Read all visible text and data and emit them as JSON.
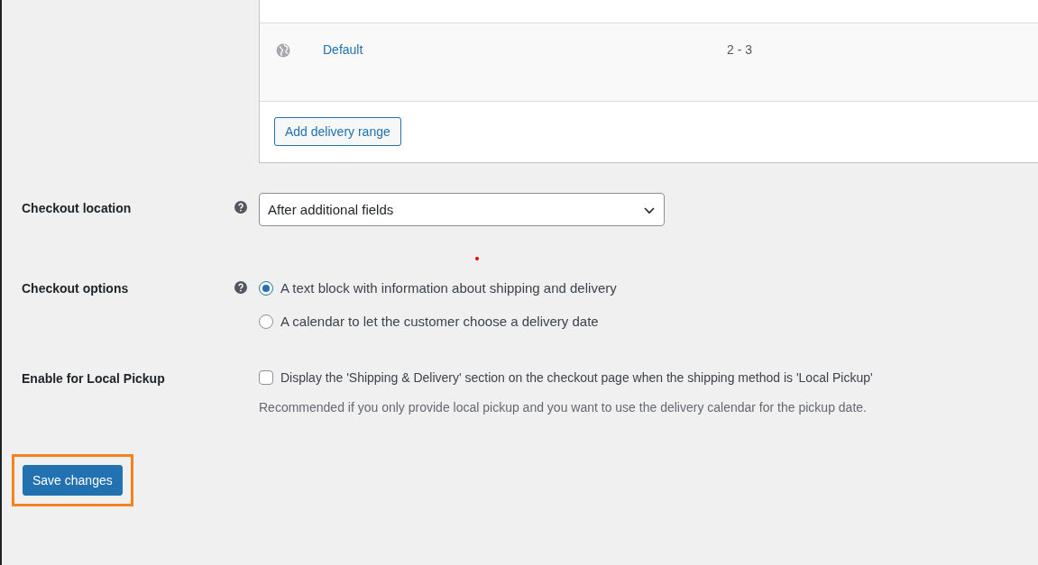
{
  "ranges_table": {
    "rows": [
      {
        "name": "Default",
        "days": "2 - 3"
      }
    ],
    "add_button": "Add delivery range"
  },
  "settings": [
    {
      "kind": "select",
      "label": "Checkout location",
      "help": true,
      "value": "After additional fields"
    },
    {
      "kind": "radio",
      "label": "Checkout options",
      "help": true,
      "options": [
        {
          "label": "A text block with information about shipping and delivery",
          "selected": true
        },
        {
          "label": "A calendar to let the customer choose a delivery date",
          "selected": false
        }
      ]
    },
    {
      "kind": "checkbox",
      "label": "Enable for Local Pickup",
      "help": false,
      "checkbox_label": "Display the 'Shipping & Delivery' section on the checkout page when the shipping method is 'Local Pickup'",
      "checked": false,
      "description": "Recommended if you only provide local pickup and you want to use the delivery calendar for the pickup date."
    }
  ],
  "save_button": {
    "label": "Save changes",
    "highlighted": true
  }
}
